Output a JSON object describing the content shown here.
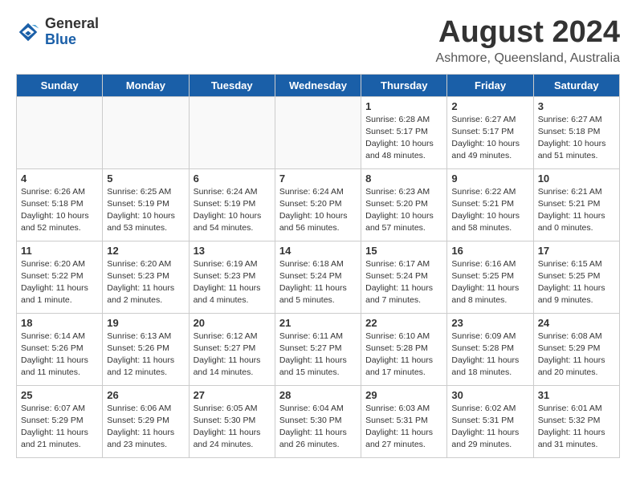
{
  "header": {
    "logo_general": "General",
    "logo_blue": "Blue",
    "month_year": "August 2024",
    "location": "Ashmore, Queensland, Australia"
  },
  "weekdays": [
    "Sunday",
    "Monday",
    "Tuesday",
    "Wednesday",
    "Thursday",
    "Friday",
    "Saturday"
  ],
  "weeks": [
    [
      {
        "day": "",
        "info": ""
      },
      {
        "day": "",
        "info": ""
      },
      {
        "day": "",
        "info": ""
      },
      {
        "day": "",
        "info": ""
      },
      {
        "day": "1",
        "info": "Sunrise: 6:28 AM\nSunset: 5:17 PM\nDaylight: 10 hours\nand 48 minutes."
      },
      {
        "day": "2",
        "info": "Sunrise: 6:27 AM\nSunset: 5:17 PM\nDaylight: 10 hours\nand 49 minutes."
      },
      {
        "day": "3",
        "info": "Sunrise: 6:27 AM\nSunset: 5:18 PM\nDaylight: 10 hours\nand 51 minutes."
      }
    ],
    [
      {
        "day": "4",
        "info": "Sunrise: 6:26 AM\nSunset: 5:18 PM\nDaylight: 10 hours\nand 52 minutes."
      },
      {
        "day": "5",
        "info": "Sunrise: 6:25 AM\nSunset: 5:19 PM\nDaylight: 10 hours\nand 53 minutes."
      },
      {
        "day": "6",
        "info": "Sunrise: 6:24 AM\nSunset: 5:19 PM\nDaylight: 10 hours\nand 54 minutes."
      },
      {
        "day": "7",
        "info": "Sunrise: 6:24 AM\nSunset: 5:20 PM\nDaylight: 10 hours\nand 56 minutes."
      },
      {
        "day": "8",
        "info": "Sunrise: 6:23 AM\nSunset: 5:20 PM\nDaylight: 10 hours\nand 57 minutes."
      },
      {
        "day": "9",
        "info": "Sunrise: 6:22 AM\nSunset: 5:21 PM\nDaylight: 10 hours\nand 58 minutes."
      },
      {
        "day": "10",
        "info": "Sunrise: 6:21 AM\nSunset: 5:21 PM\nDaylight: 11 hours\nand 0 minutes."
      }
    ],
    [
      {
        "day": "11",
        "info": "Sunrise: 6:20 AM\nSunset: 5:22 PM\nDaylight: 11 hours\nand 1 minute."
      },
      {
        "day": "12",
        "info": "Sunrise: 6:20 AM\nSunset: 5:23 PM\nDaylight: 11 hours\nand 2 minutes."
      },
      {
        "day": "13",
        "info": "Sunrise: 6:19 AM\nSunset: 5:23 PM\nDaylight: 11 hours\nand 4 minutes."
      },
      {
        "day": "14",
        "info": "Sunrise: 6:18 AM\nSunset: 5:24 PM\nDaylight: 11 hours\nand 5 minutes."
      },
      {
        "day": "15",
        "info": "Sunrise: 6:17 AM\nSunset: 5:24 PM\nDaylight: 11 hours\nand 7 minutes."
      },
      {
        "day": "16",
        "info": "Sunrise: 6:16 AM\nSunset: 5:25 PM\nDaylight: 11 hours\nand 8 minutes."
      },
      {
        "day": "17",
        "info": "Sunrise: 6:15 AM\nSunset: 5:25 PM\nDaylight: 11 hours\nand 9 minutes."
      }
    ],
    [
      {
        "day": "18",
        "info": "Sunrise: 6:14 AM\nSunset: 5:26 PM\nDaylight: 11 hours\nand 11 minutes."
      },
      {
        "day": "19",
        "info": "Sunrise: 6:13 AM\nSunset: 5:26 PM\nDaylight: 11 hours\nand 12 minutes."
      },
      {
        "day": "20",
        "info": "Sunrise: 6:12 AM\nSunset: 5:27 PM\nDaylight: 11 hours\nand 14 minutes."
      },
      {
        "day": "21",
        "info": "Sunrise: 6:11 AM\nSunset: 5:27 PM\nDaylight: 11 hours\nand 15 minutes."
      },
      {
        "day": "22",
        "info": "Sunrise: 6:10 AM\nSunset: 5:28 PM\nDaylight: 11 hours\nand 17 minutes."
      },
      {
        "day": "23",
        "info": "Sunrise: 6:09 AM\nSunset: 5:28 PM\nDaylight: 11 hours\nand 18 minutes."
      },
      {
        "day": "24",
        "info": "Sunrise: 6:08 AM\nSunset: 5:29 PM\nDaylight: 11 hours\nand 20 minutes."
      }
    ],
    [
      {
        "day": "25",
        "info": "Sunrise: 6:07 AM\nSunset: 5:29 PM\nDaylight: 11 hours\nand 21 minutes."
      },
      {
        "day": "26",
        "info": "Sunrise: 6:06 AM\nSunset: 5:29 PM\nDaylight: 11 hours\nand 23 minutes."
      },
      {
        "day": "27",
        "info": "Sunrise: 6:05 AM\nSunset: 5:30 PM\nDaylight: 11 hours\nand 24 minutes."
      },
      {
        "day": "28",
        "info": "Sunrise: 6:04 AM\nSunset: 5:30 PM\nDaylight: 11 hours\nand 26 minutes."
      },
      {
        "day": "29",
        "info": "Sunrise: 6:03 AM\nSunset: 5:31 PM\nDaylight: 11 hours\nand 27 minutes."
      },
      {
        "day": "30",
        "info": "Sunrise: 6:02 AM\nSunset: 5:31 PM\nDaylight: 11 hours\nand 29 minutes."
      },
      {
        "day": "31",
        "info": "Sunrise: 6:01 AM\nSunset: 5:32 PM\nDaylight: 11 hours\nand 31 minutes."
      }
    ]
  ]
}
